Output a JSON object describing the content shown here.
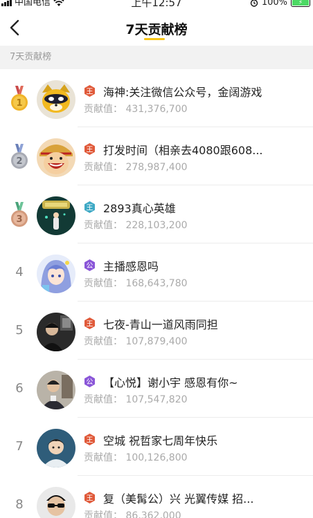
{
  "status_bar": {
    "carrier": "中国电信",
    "time": "上午12:57",
    "battery": "100%",
    "icons": [
      "signal-icon",
      "wifi-icon",
      "alarm-icon",
      "battery-icon"
    ]
  },
  "nav": {
    "title": "7天贡献榜",
    "back_icon": "back-chevron-icon",
    "accent": "#f7c516"
  },
  "section": {
    "label": "7天贡献榜"
  },
  "colors": {
    "gold": "#f0b429",
    "silver": "#a7aab3",
    "bronze": "#d39a7c",
    "badge_red": "#e05a3a",
    "badge_purple": "#8a56d8",
    "badge_teal": "#3fa9c5"
  },
  "entries": [
    {
      "rank": "1",
      "medal": "gold-medal-icon",
      "badge": "王",
      "badge_color": "#e05a3a",
      "name": "海神:关注微信公众号，金阔游戏",
      "score_label": "贡献值：",
      "score": "431,376,700",
      "avatar": "cartoon-raccoon-avatar"
    },
    {
      "rank": "2",
      "medal": "silver-medal-icon",
      "badge": "王",
      "badge_color": "#e05a3a",
      "name": "打发时间（相亲去4080跟608...",
      "score_label": "贡献值：",
      "score": "278,987,400",
      "avatar": "anime-character-avatar"
    },
    {
      "rank": "3",
      "medal": "bronze-medal-icon",
      "badge": "王",
      "badge_color": "#3fa9c5",
      "name": "2893真心英雄",
      "score_label": "贡献值：",
      "score": "228,103,200",
      "avatar": "dark-green-poster-avatar"
    },
    {
      "rank": "4",
      "medal": "",
      "badge": "公",
      "badge_color": "#8a56d8",
      "name": "主播感恩吗",
      "score_label": "贡献值：",
      "score": "168,643,780",
      "avatar": "anime-girl-avatar"
    },
    {
      "rank": "5",
      "medal": "",
      "badge": "王",
      "badge_color": "#e05a3a",
      "name": "七夜-青山一道风雨同担",
      "score_label": "贡献值：",
      "score": "107,879,400",
      "avatar": "dark-photo-avatar"
    },
    {
      "rank": "6",
      "medal": "",
      "badge": "公",
      "badge_color": "#8a56d8",
      "name": "【心悦】谢小宇 感恩有你~",
      "score_label": "贡献值：",
      "score": "107,547,820",
      "avatar": "man-photo-avatar"
    },
    {
      "rank": "7",
      "medal": "",
      "badge": "王",
      "badge_color": "#e05a3a",
      "name": "空城 祝哲家七周年快乐",
      "score_label": "贡献值：",
      "score": "100,126,800",
      "avatar": "portrait-avatar"
    },
    {
      "rank": "8",
      "medal": "",
      "badge": "王",
      "badge_color": "#e05a3a",
      "name": "复（美髯公）兴 光翼传媒 招...",
      "score_label": "贡献值：",
      "score": "86,362,000",
      "avatar": "sunglasses-man-avatar"
    }
  ]
}
